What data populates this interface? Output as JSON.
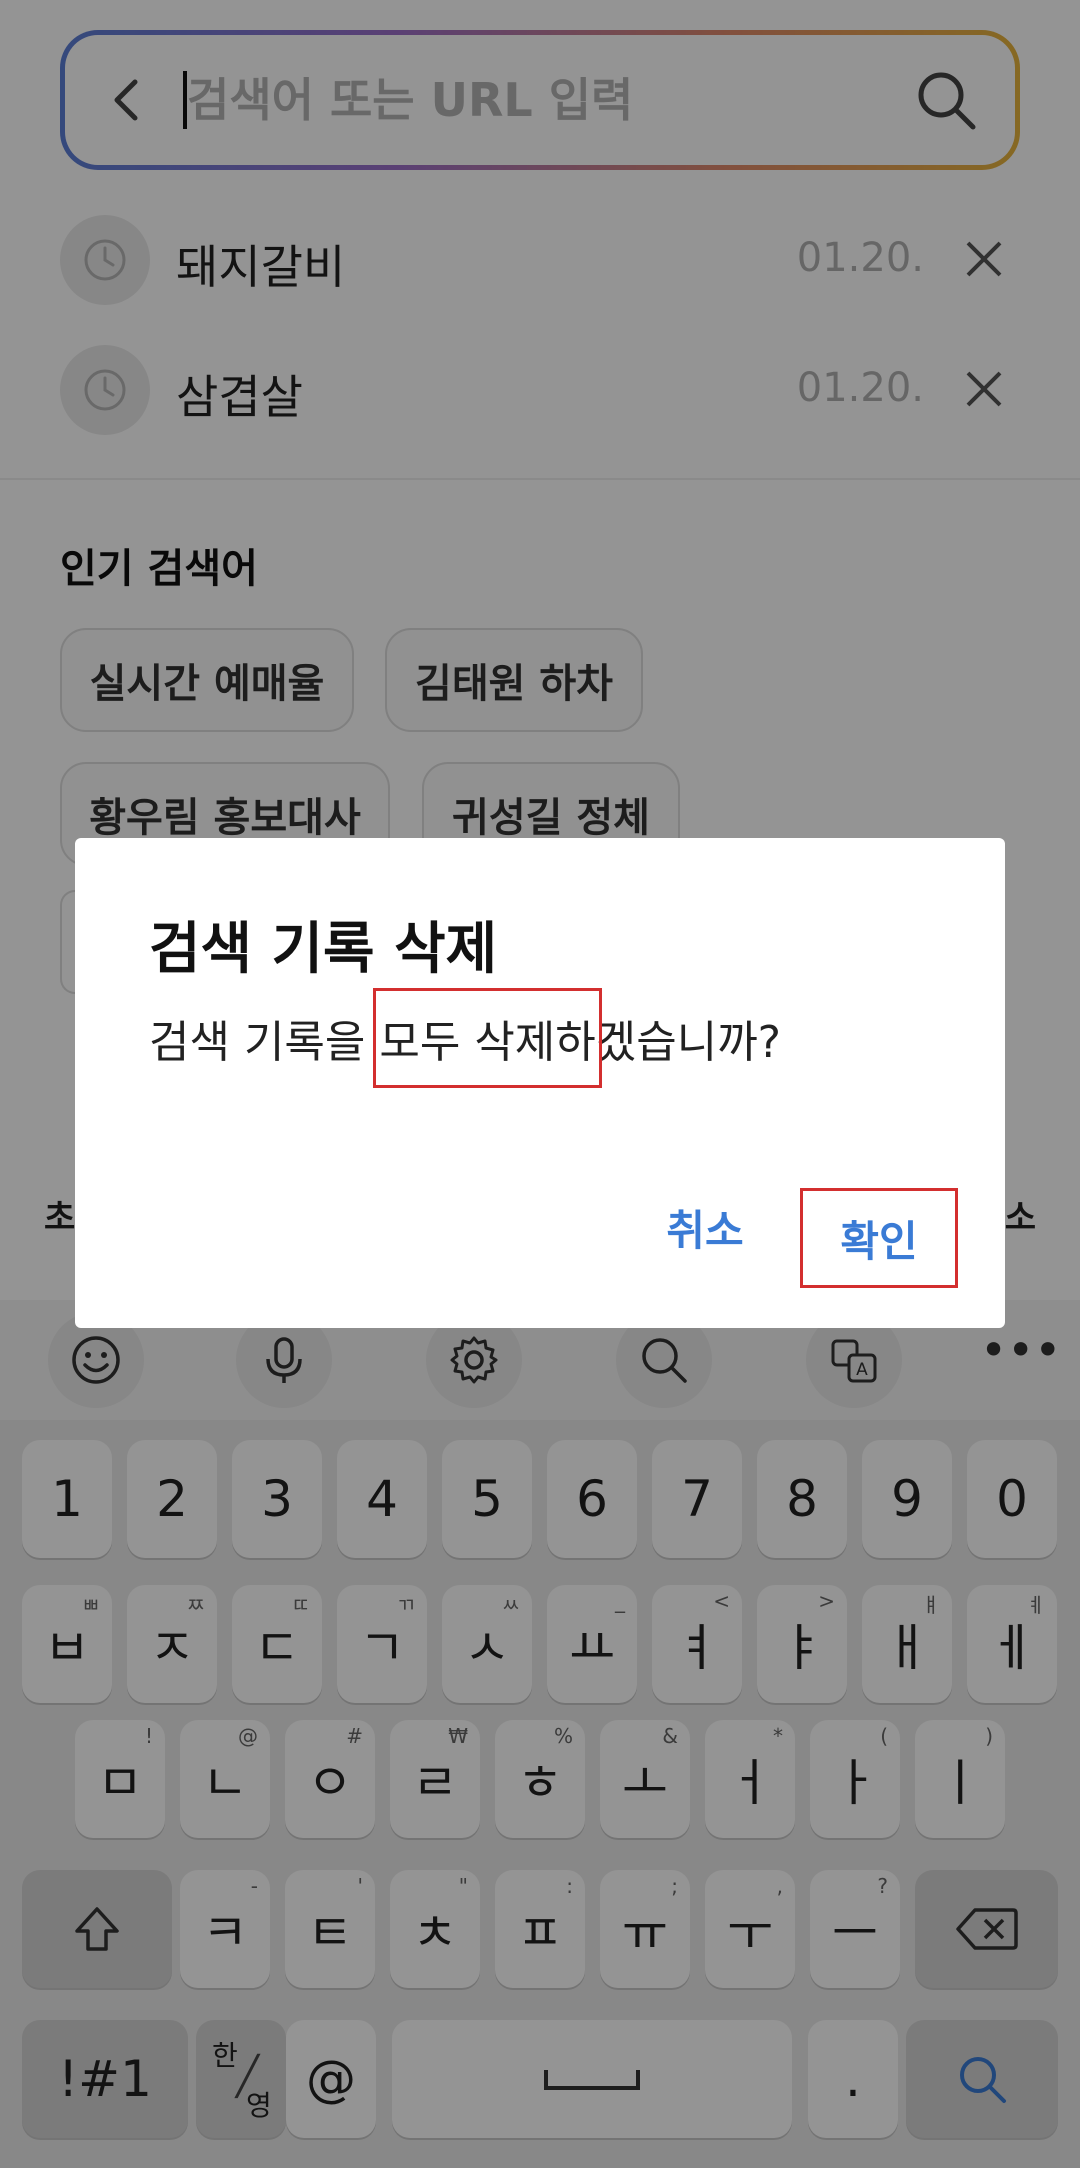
{
  "search": {
    "placeholder": "검색어 또는 URL 입력"
  },
  "history": [
    {
      "term": "돼지갈비",
      "date": "01.20."
    },
    {
      "term": "삼겹살",
      "date": "01.20."
    }
  ],
  "popular": {
    "title": "인기 검색어",
    "chips": [
      "실시간 예매율",
      "김태원 하차",
      "황우림 홍보대사",
      "귀성길 정체"
    ]
  },
  "under_row": {
    "left": "초",
    "right": "소"
  },
  "dialog": {
    "title": "검색 기록 삭제",
    "message_pre": "검색 기록을 ",
    "message_highlight": "모두 삭제하",
    "message_post": "겠습니까?",
    "cancel_label": "취소",
    "confirm_label": "확인"
  },
  "keyboard": {
    "numbers": [
      "1",
      "2",
      "3",
      "4",
      "5",
      "6",
      "7",
      "8",
      "9",
      "0"
    ],
    "row2": [
      {
        "key": "ㅂ",
        "hint": "ㅃ"
      },
      {
        "key": "ㅈ",
        "hint": "ㅉ"
      },
      {
        "key": "ㄷ",
        "hint": "ㄸ"
      },
      {
        "key": "ㄱ",
        "hint": "ㄲ"
      },
      {
        "key": "ㅅ",
        "hint": "ㅆ"
      },
      {
        "key": "ㅛ",
        "hint": "_"
      },
      {
        "key": "ㅕ",
        "hint": "<"
      },
      {
        "key": "ㅑ",
        "hint": ">"
      },
      {
        "key": "ㅐ",
        "hint": "ㅒ"
      },
      {
        "key": "ㅔ",
        "hint": "ㅖ"
      }
    ],
    "row3": [
      {
        "key": "ㅁ",
        "hint": "!"
      },
      {
        "key": "ㄴ",
        "hint": "@"
      },
      {
        "key": "ㅇ",
        "hint": "#"
      },
      {
        "key": "ㄹ",
        "hint": "₩"
      },
      {
        "key": "ㅎ",
        "hint": "%"
      },
      {
        "key": "ㅗ",
        "hint": "&"
      },
      {
        "key": "ㅓ",
        "hint": "*"
      },
      {
        "key": "ㅏ",
        "hint": "("
      },
      {
        "key": "ㅣ",
        "hint": ")"
      }
    ],
    "row4": [
      {
        "key": "ㅋ",
        "hint": "-"
      },
      {
        "key": "ㅌ",
        "hint": "'"
      },
      {
        "key": "ㅊ",
        "hint": "\""
      },
      {
        "key": "ㅍ",
        "hint": ":"
      },
      {
        "key": "ㅠ",
        "hint": ";"
      },
      {
        "key": "ㅜ",
        "hint": ","
      },
      {
        "key": "ㅡ",
        "hint": "?"
      }
    ],
    "symbols_label": "!#1",
    "lang_top": "한",
    "lang_bottom": "영",
    "at_label": "@",
    "period_label": "."
  },
  "colors": {
    "accent": "#3a7bd5",
    "highlight_box": "#d32f2f"
  }
}
